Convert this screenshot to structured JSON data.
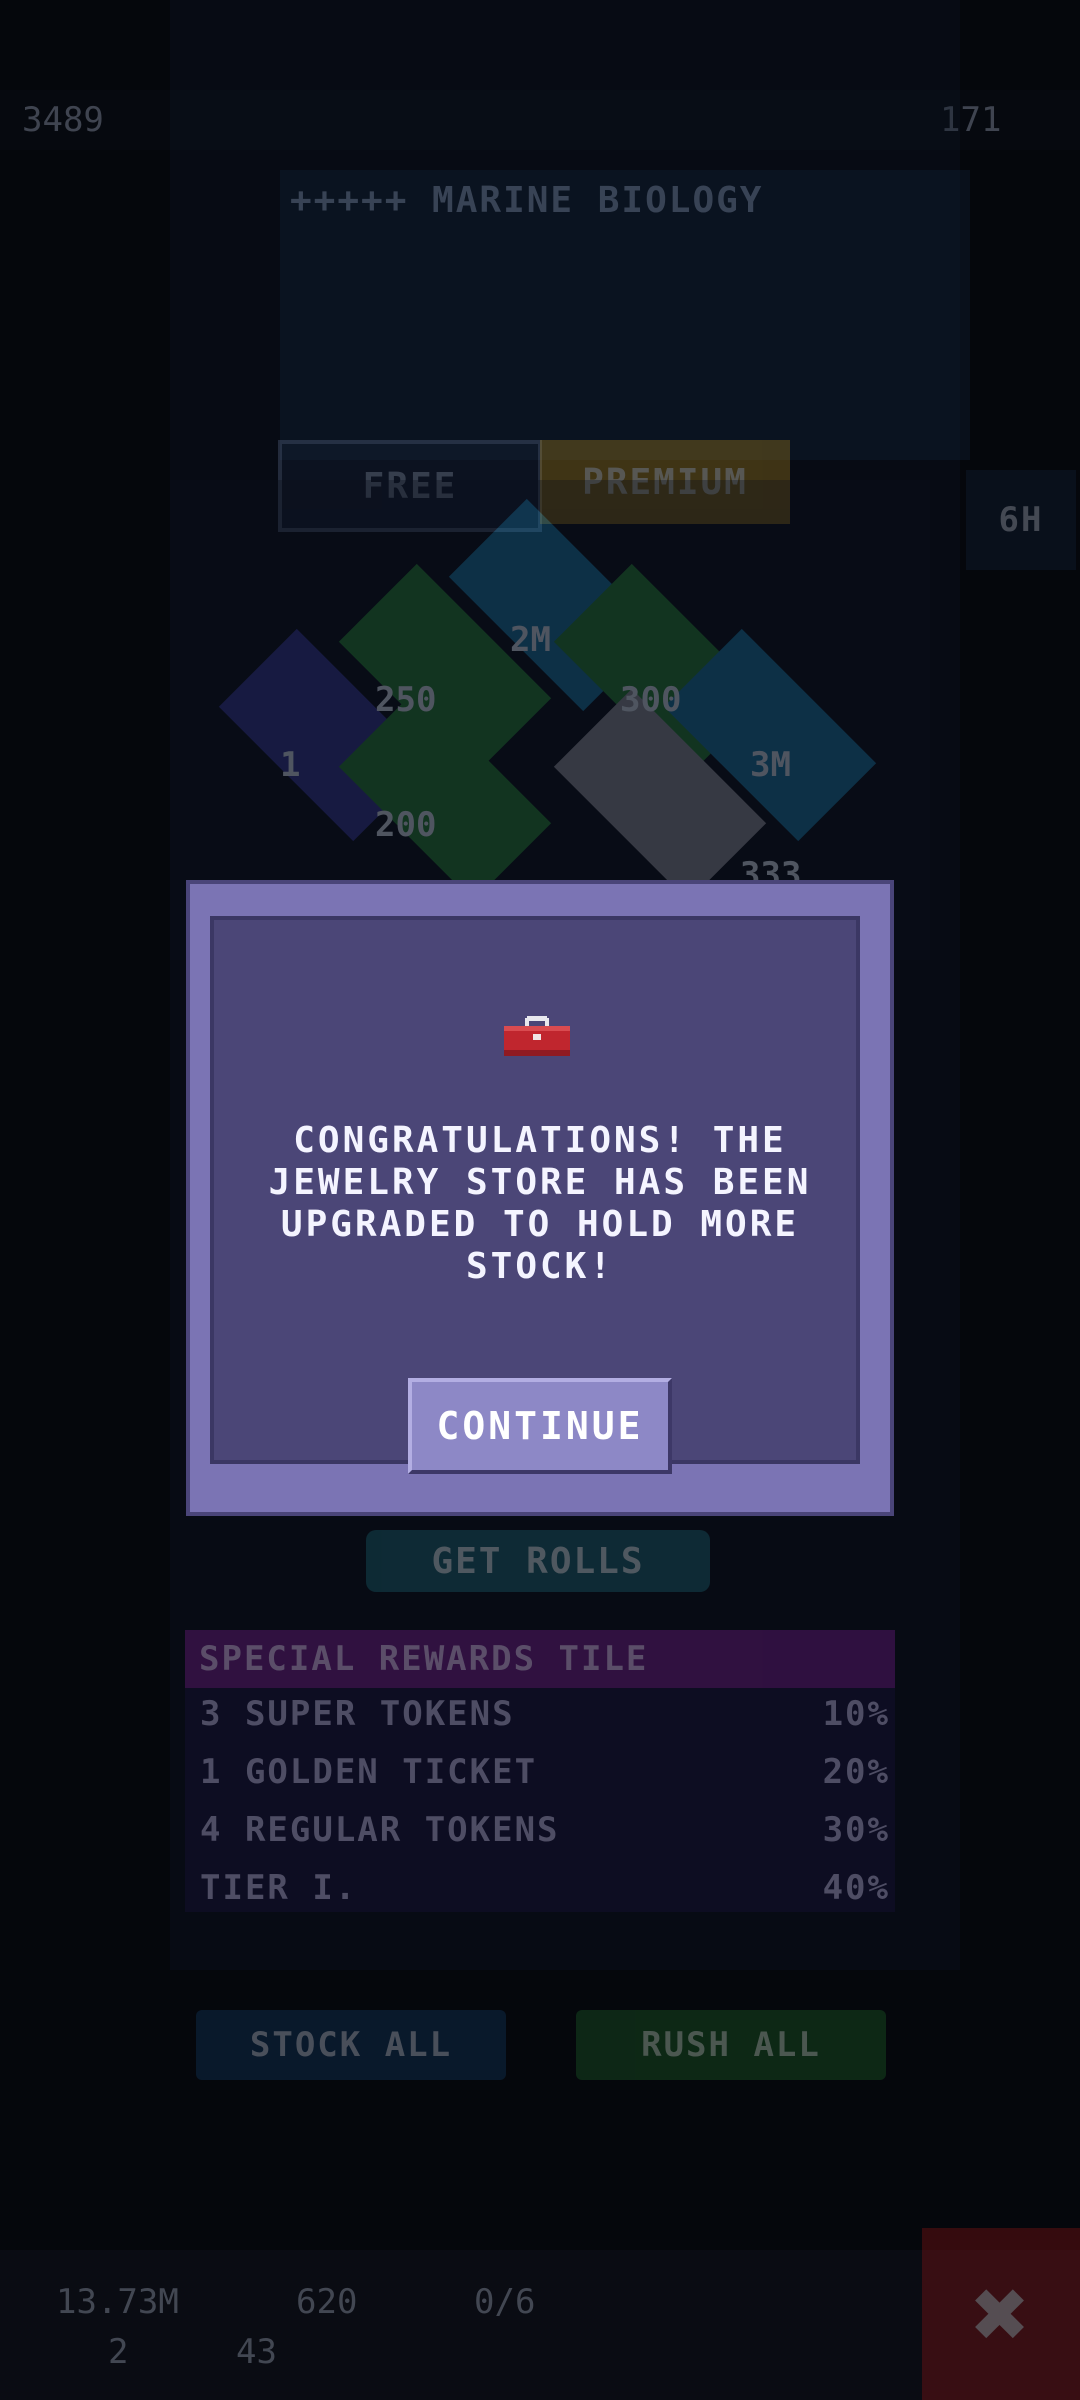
{
  "status": {
    "left_count": "3489",
    "right_count": "171"
  },
  "event": {
    "title": "+++++ MARINE BIOLOGY",
    "tabs": [
      "FREE",
      "PREMIUM"
    ],
    "side_timer": "6H"
  },
  "board_tiles": [
    "2M",
    "250",
    "300",
    "1",
    "3M",
    "200",
    "333"
  ],
  "get_rolls_label": "GET ROLLS",
  "special_rewards": {
    "title": "SPECIAL REWARDS TILE",
    "rows": [
      {
        "label": "3 SUPER TOKENS",
        "pct": "10%"
      },
      {
        "label": "1 GOLDEN TICKET",
        "pct": "20%"
      },
      {
        "label": "4 REGULAR TOKENS",
        "pct": "30%"
      },
      {
        "label": "TIER I.",
        "pct": "40%"
      }
    ]
  },
  "actions": {
    "stock_all": "STOCK ALL",
    "rush_all": "RUSH ALL"
  },
  "footer": {
    "coins": "13.73M",
    "bux": "620",
    "tickets": "0/6",
    "gems": "2",
    "level": "43"
  },
  "modal": {
    "message": "CONGRATULATIONS! THE JEWELRY STORE HAS BEEN UPGRADED TO HOLD MORE STOCK!",
    "button": "CONTINUE"
  },
  "colors": {
    "modal_border": "#7b74b4",
    "modal_fill": "#4b4677",
    "button": "#8d88c6",
    "toolbox": "#c0262e"
  }
}
